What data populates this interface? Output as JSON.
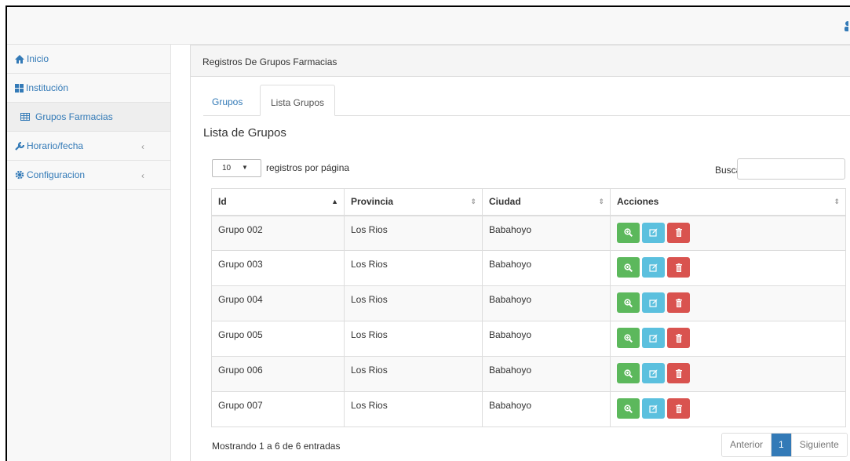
{
  "sidebar": {
    "items": [
      {
        "label": "Inicio",
        "icon": "home-icon"
      },
      {
        "label": "Institución",
        "icon": "grid-icon"
      },
      {
        "label": "Grupos Farmacias",
        "icon": "table-icon"
      },
      {
        "label": "Horario/fecha",
        "icon": "wrench-icon"
      },
      {
        "label": "Configuracion",
        "icon": "gear-icon"
      }
    ]
  },
  "panel": {
    "heading": "Registros De Grupos Farmacias",
    "tabs": [
      "Grupos",
      "Lista Grupos"
    ],
    "active_tab": "Lista Grupos",
    "list_title": "Lista de Grupos"
  },
  "controls": {
    "page_length": "10",
    "page_length_label": "registros por página",
    "search_label": "Buscar:",
    "search_value": ""
  },
  "table": {
    "headers": [
      "Id",
      "Provincia",
      "Ciudad",
      "Acciones"
    ],
    "rows": [
      [
        "Grupo 002",
        "Los Rios",
        "Babahoyo"
      ],
      [
        "Grupo 003",
        "Los Rios",
        "Babahoyo"
      ],
      [
        "Grupo 004",
        "Los Rios",
        "Babahoyo"
      ],
      [
        "Grupo 005",
        "Los Rios",
        "Babahoyo"
      ],
      [
        "Grupo 006",
        "Los Rios",
        "Babahoyo"
      ],
      [
        "Grupo 007",
        "Los Rios",
        "Babahoyo"
      ]
    ],
    "actions": [
      "view-icon",
      "edit-icon",
      "delete-icon"
    ]
  },
  "footer": {
    "info": "Mostrando 1 a 6 de 6 entradas",
    "prev": "Anterior",
    "current_page": "1",
    "next": "Siguiente"
  },
  "colors": {
    "link": "#337ab7",
    "view_button": "#5cb85c",
    "edit_button": "#5bc0de",
    "delete_button": "#d9534f"
  }
}
